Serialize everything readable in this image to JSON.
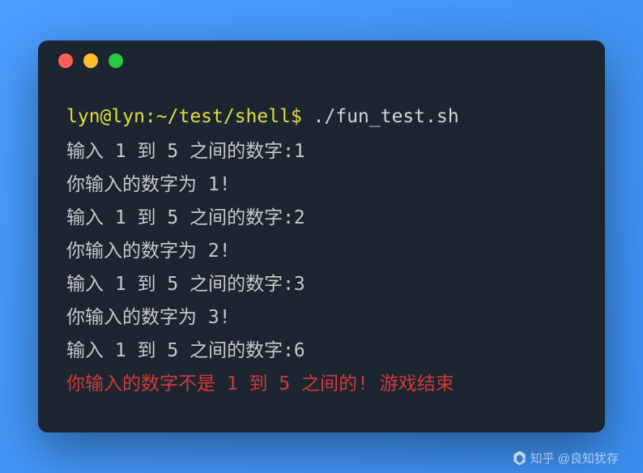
{
  "prompt": "lyn@lyn:~/test/shell$",
  "command": "./fun_test.sh",
  "lines": [
    "输入 1 到 5 之间的数字:1",
    "你输入的数字为 1!",
    "输入 1 到 5 之间的数字:2",
    "你输入的数字为 2!",
    "输入 1 到 5 之间的数字:3",
    "你输入的数字为 3!",
    "输入 1 到 5 之间的数字:6"
  ],
  "error_line": "你输入的数字不是 1 到 5 之间的! 游戏结束",
  "watermark": "知乎 @良知犹存"
}
